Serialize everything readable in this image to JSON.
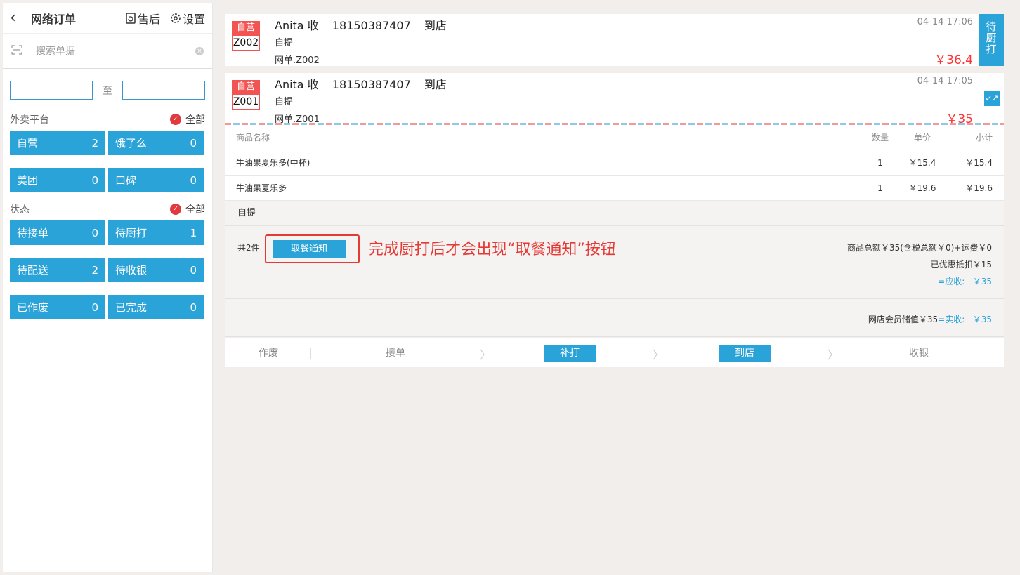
{
  "header": {
    "back_icon": "‹",
    "title": "网络订单",
    "aftersale_label": "售后",
    "settings_label": "设置"
  },
  "search": {
    "placeholder": "搜索单据",
    "value": ""
  },
  "date_range": {
    "from": "",
    "separator": "至",
    "to": ""
  },
  "platform": {
    "heading": "外卖平台",
    "all_label": "全部",
    "items": [
      {
        "label": "自营",
        "count": "2"
      },
      {
        "label": "饿了么",
        "count": "0"
      },
      {
        "label": "美团",
        "count": "0"
      },
      {
        "label": "口碑",
        "count": "0"
      }
    ]
  },
  "status": {
    "heading": "状态",
    "all_label": "全部",
    "items": [
      {
        "label": "待接单",
        "count": "0"
      },
      {
        "label": "待厨打",
        "count": "1"
      },
      {
        "label": "待配送",
        "count": "2"
      },
      {
        "label": "待收银",
        "count": "0"
      },
      {
        "label": "已作废",
        "count": "0"
      },
      {
        "label": "已完成",
        "count": "0"
      }
    ]
  },
  "orders": [
    {
      "tag_top": "自营",
      "tag_code": "Z002",
      "customer": "Anita 收",
      "phone": "18150387407",
      "mode": "到店",
      "sub": "自提",
      "order_no": "网单.Z002",
      "time": "04-14 17:06",
      "price": "￥36.4",
      "side_label": "待厨打"
    },
    {
      "tag_top": "自营",
      "tag_code": "Z001",
      "customer": "Anita 收",
      "phone": "18150387407",
      "mode": "到店",
      "sub": "自提",
      "order_no": "网单.Z001",
      "time": "04-14 17:05",
      "price": "￥35"
    }
  ],
  "detail": {
    "headers": {
      "name": "商品名称",
      "qty": "数量",
      "price": "单价",
      "sub": "小计"
    },
    "items": [
      {
        "name": "牛油果夏乐多(中杯)",
        "qty": "1",
        "price": "￥15.4",
        "sub": "￥15.4"
      },
      {
        "name": "牛油果夏乐多",
        "qty": "1",
        "price": "￥19.6",
        "sub": "￥19.6"
      }
    ],
    "method": "自提",
    "count": "共2件",
    "notify_label": "取餐通知",
    "annotation": "完成厨打后才会出现“取餐通知”按钮",
    "total": "商品总额￥35(含税总额￥0)+运费￥0",
    "discount": "已优惠抵扣￥15",
    "receivable_label": "=应收:",
    "receivable_value": "￥35",
    "member_label": "网店会员储值￥35",
    "paid_label": "=实收:",
    "paid_value": "￥35"
  },
  "actions": {
    "void": "作废",
    "accept": "接单",
    "reprint": "补打",
    "arrive": "到店",
    "cashier": "收银"
  },
  "colors": {
    "accent": "#2aa3d8",
    "tag_red": "#f25353",
    "price_red": "#ff3333",
    "annotation_red": "#e53935"
  }
}
